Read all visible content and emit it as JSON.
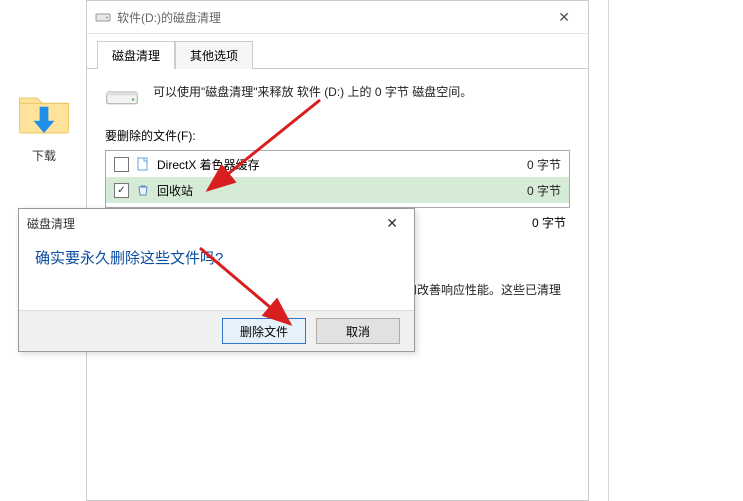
{
  "desktop": {
    "folder_label": "下载"
  },
  "window": {
    "title": "软件(D:)的磁盘清理",
    "tabs": {
      "active": "磁盘清理",
      "inactive": "其他选项"
    },
    "summary": "可以使用\"磁盘清理\"来释放 软件 (D:) 上的 0 字节 磁盘空间。",
    "files_label": "要删除的文件(F):",
    "items": [
      {
        "name": "DirectX 着色器缓存",
        "size": "0 字节",
        "checked": false
      },
      {
        "name": "回收站",
        "size": "0 字节",
        "checked": true
      }
    ],
    "total_size": "0 字节",
    "description": "通过清理图形系统创建的文件，可缩短应用程序加载时间和改善响应性能。这些已清理的文件将在需要时重新生成。"
  },
  "dialog": {
    "title": "磁盘清理",
    "message": "确实要永久删除这些文件吗?",
    "confirm": "删除文件",
    "cancel": "取消"
  }
}
